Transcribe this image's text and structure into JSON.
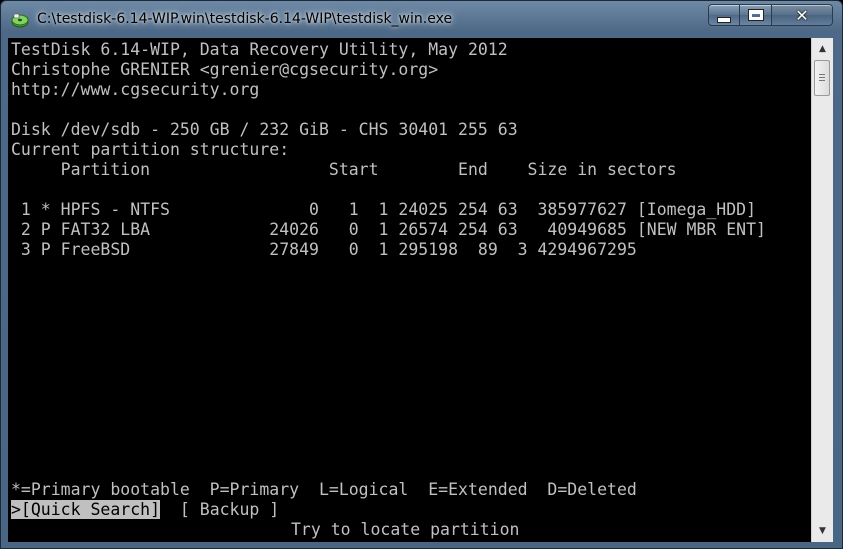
{
  "window": {
    "title": "C:\\testdisk-6.14-WIP.win\\testdisk-6.14-WIP\\testdisk_win.exe",
    "close_glyph": "✕",
    "icons": [
      "testdisk-app-icon",
      "minimize-icon",
      "maximize-icon",
      "close-icon"
    ]
  },
  "console": {
    "header": [
      "TestDisk 6.14-WIP, Data Recovery Utility, May 2012",
      "Christophe GRENIER <grenier@cgsecurity.org>",
      "http://www.cgsecurity.org"
    ],
    "disk_info": "Disk /dev/sdb - 250 GB / 232 GiB - CHS 30401 255 63",
    "structure_title": "Current partition structure:",
    "columns_line": "     Partition                  Start        End    Size in sectors",
    "partitions": [
      " 1 * HPFS - NTFS              0   1  1 24025 254 63  385977627 [Iomega_HDD]",
      " 2 P FAT32 LBA            24026   0  1 26574 254 63   40949685 [NEW MBR ENT]",
      " 3 P FreeBSD              27849   0  1 295198  89  3 4294967295"
    ],
    "legend": "*=Primary bootable  P=Primary  L=Logical  E=Extended  D=Deleted",
    "menu": {
      "quick_search": ">[Quick Search]",
      "backup": "[ Backup ]"
    },
    "hint": "Try to locate partition"
  },
  "colors": {
    "console_bg": "#000000",
    "console_fg": "#c0c0c0",
    "titlebar": "#4d6987"
  }
}
